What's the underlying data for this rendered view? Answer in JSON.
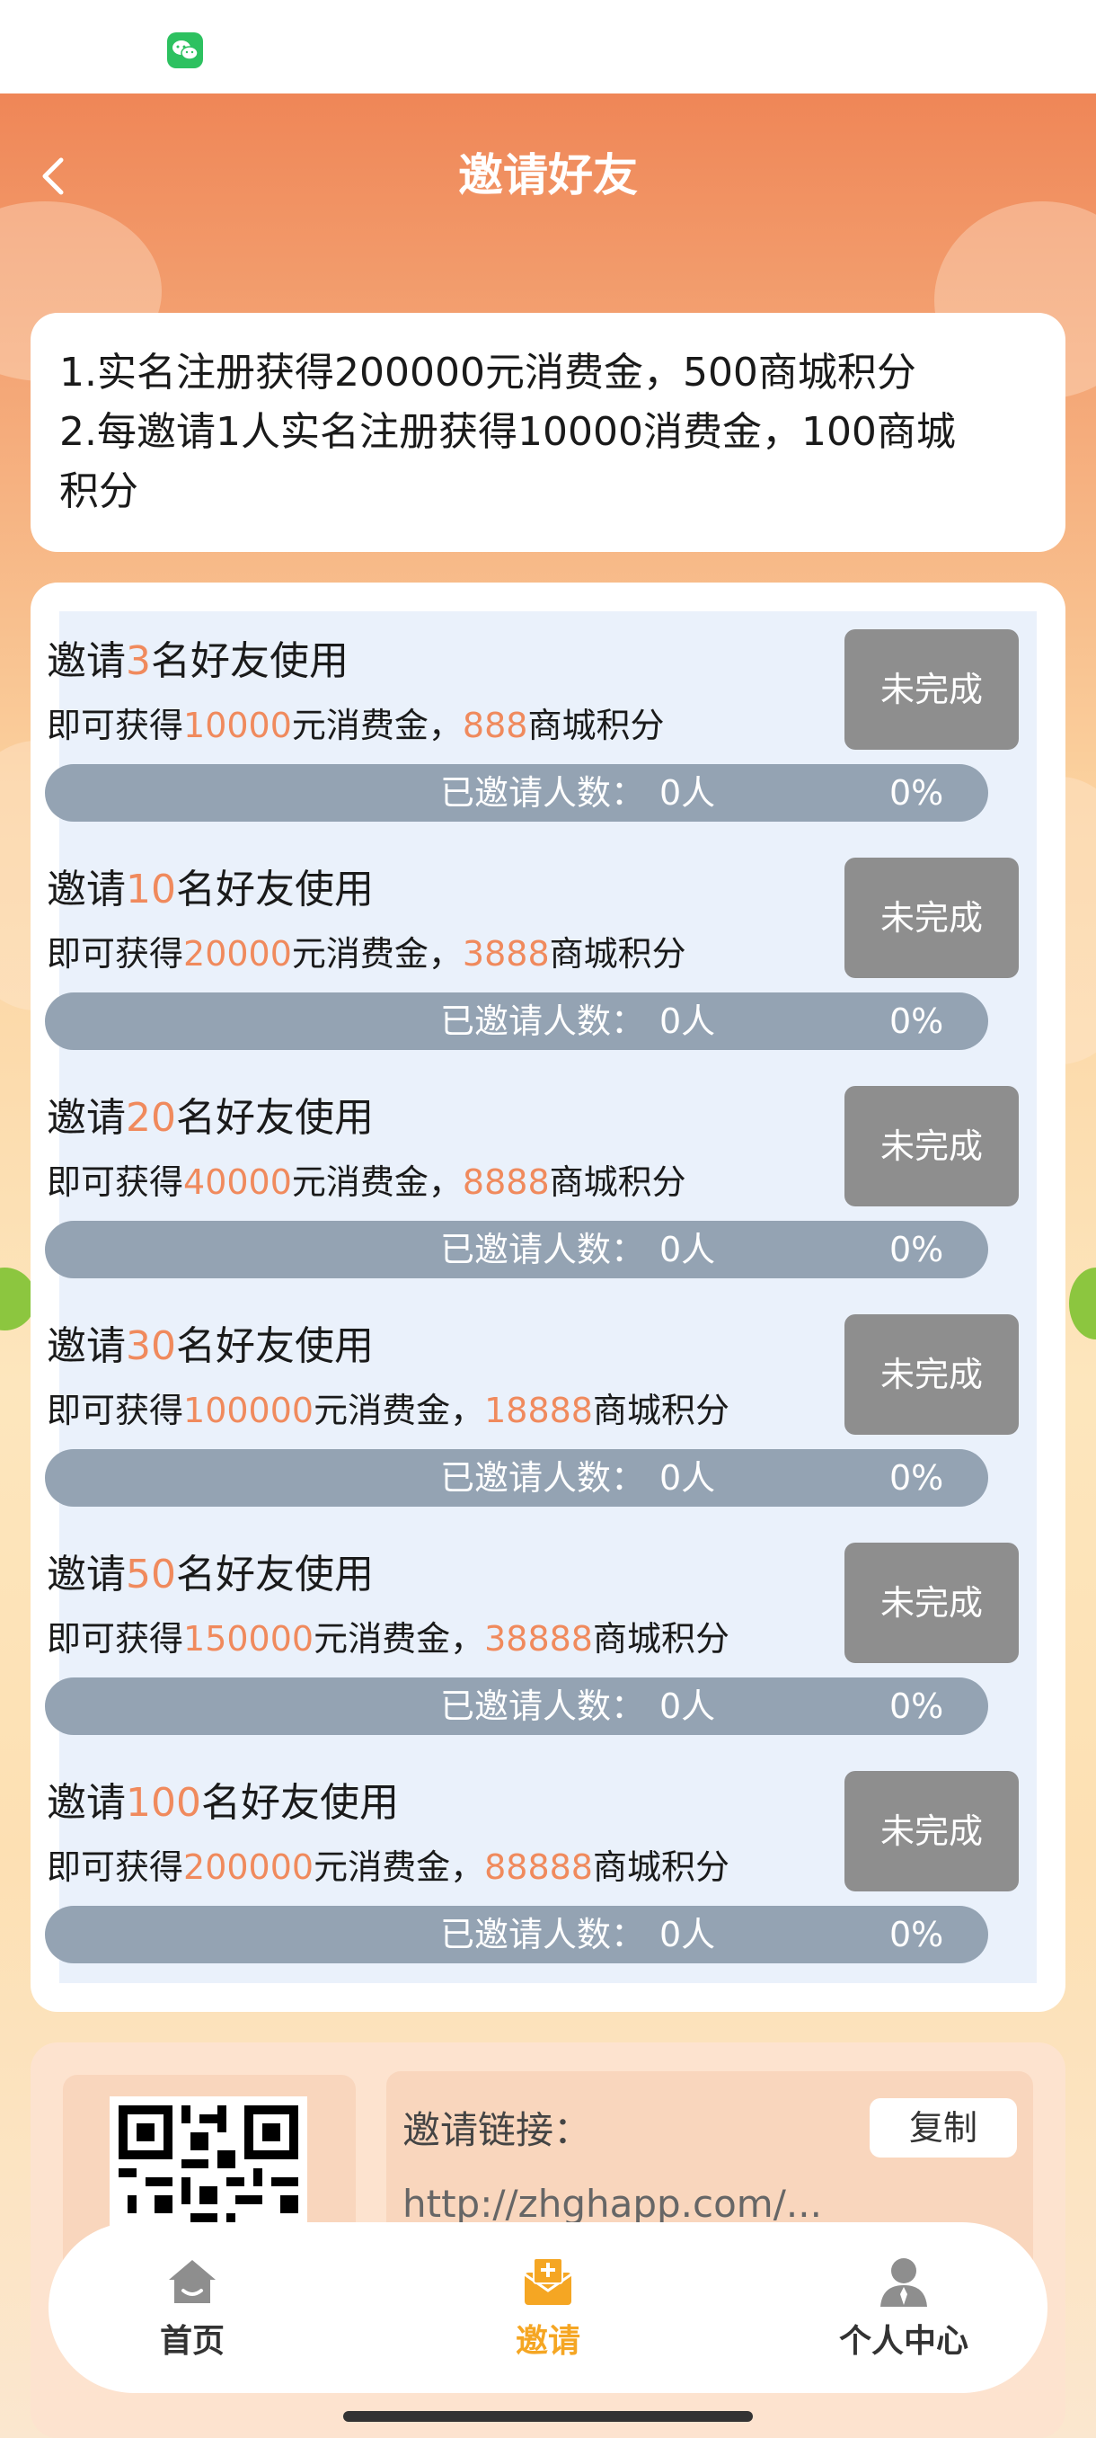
{
  "status_bar": {
    "app_icon": "wechat-icon"
  },
  "nav": {
    "title": "邀请好友",
    "back_icon": "chevron-left-icon"
  },
  "rules": {
    "lines": [
      "1.实名注册获得200000元消费金，500商城积分",
      "2.每邀请1人实名注册获得10000消费金，100商城",
      "积分"
    ]
  },
  "tasks": [
    {
      "prefix": "邀请",
      "count": "3",
      "suffix": "名好友使用",
      "reward_prefix": "即可获得",
      "money": "10000",
      "money_suffix": "元消费金，",
      "points": "888",
      "points_suffix": "商城积分",
      "status": "未完成",
      "progress_label": "已邀请人数：",
      "progress_count": "0人",
      "progress_percent": "0%",
      "progress": 0
    },
    {
      "prefix": "邀请",
      "count": "10",
      "suffix": "名好友使用",
      "reward_prefix": "即可获得",
      "money": "20000",
      "money_suffix": "元消费金，",
      "points": "3888",
      "points_suffix": "商城积分",
      "status": "未完成",
      "progress_label": "已邀请人数：",
      "progress_count": "0人",
      "progress_percent": "0%",
      "progress": 0
    },
    {
      "prefix": "邀请",
      "count": "20",
      "suffix": "名好友使用",
      "reward_prefix": "即可获得",
      "money": "40000",
      "money_suffix": "元消费金，",
      "points": "8888",
      "points_suffix": "商城积分",
      "status": "未完成",
      "progress_label": "已邀请人数：",
      "progress_count": "0人",
      "progress_percent": "0%",
      "progress": 0
    },
    {
      "prefix": "邀请",
      "count": "30",
      "suffix": "名好友使用",
      "reward_prefix": "即可获得",
      "money": "100000",
      "money_suffix": "元消费金，",
      "points": "18888",
      "points_suffix": "商城积分",
      "status": "未完成",
      "progress_label": "已邀请人数：",
      "progress_count": "0人",
      "progress_percent": "0%",
      "progress": 0
    },
    {
      "prefix": "邀请",
      "count": "50",
      "suffix": "名好友使用",
      "reward_prefix": "即可获得",
      "money": "150000",
      "money_suffix": "元消费金，",
      "points": "38888",
      "points_suffix": "商城积分",
      "status": "未完成",
      "progress_label": "已邀请人数：",
      "progress_count": "0人",
      "progress_percent": "0%",
      "progress": 0
    },
    {
      "prefix": "邀请",
      "count": "100",
      "suffix": "名好友使用",
      "reward_prefix": "即可获得",
      "money": "200000",
      "money_suffix": "元消费金，",
      "points": "88888",
      "points_suffix": "商城积分",
      "status": "未完成",
      "progress_label": "已邀请人数：",
      "progress_count": "0人",
      "progress_percent": "0%",
      "progress": 0
    }
  ],
  "invite": {
    "qr_icon": "qr-code-icon",
    "link_label": "邀请链接：",
    "copy_label": "复制",
    "link_url": "http://zhghapp.com/..."
  },
  "tabbar": {
    "items": [
      {
        "label": "首页",
        "icon": "home-icon",
        "active": false
      },
      {
        "label": "邀请",
        "icon": "invite-icon",
        "active": true
      },
      {
        "label": "个人中心",
        "icon": "user-icon",
        "active": false
      }
    ]
  },
  "colors": {
    "accent": "#f08a5d",
    "header": "#ef8657",
    "active_tab": "#f5a623",
    "inactive_tab": "#333333",
    "status_button": "#8e8e8e",
    "progress_track": "#94a3b3"
  }
}
